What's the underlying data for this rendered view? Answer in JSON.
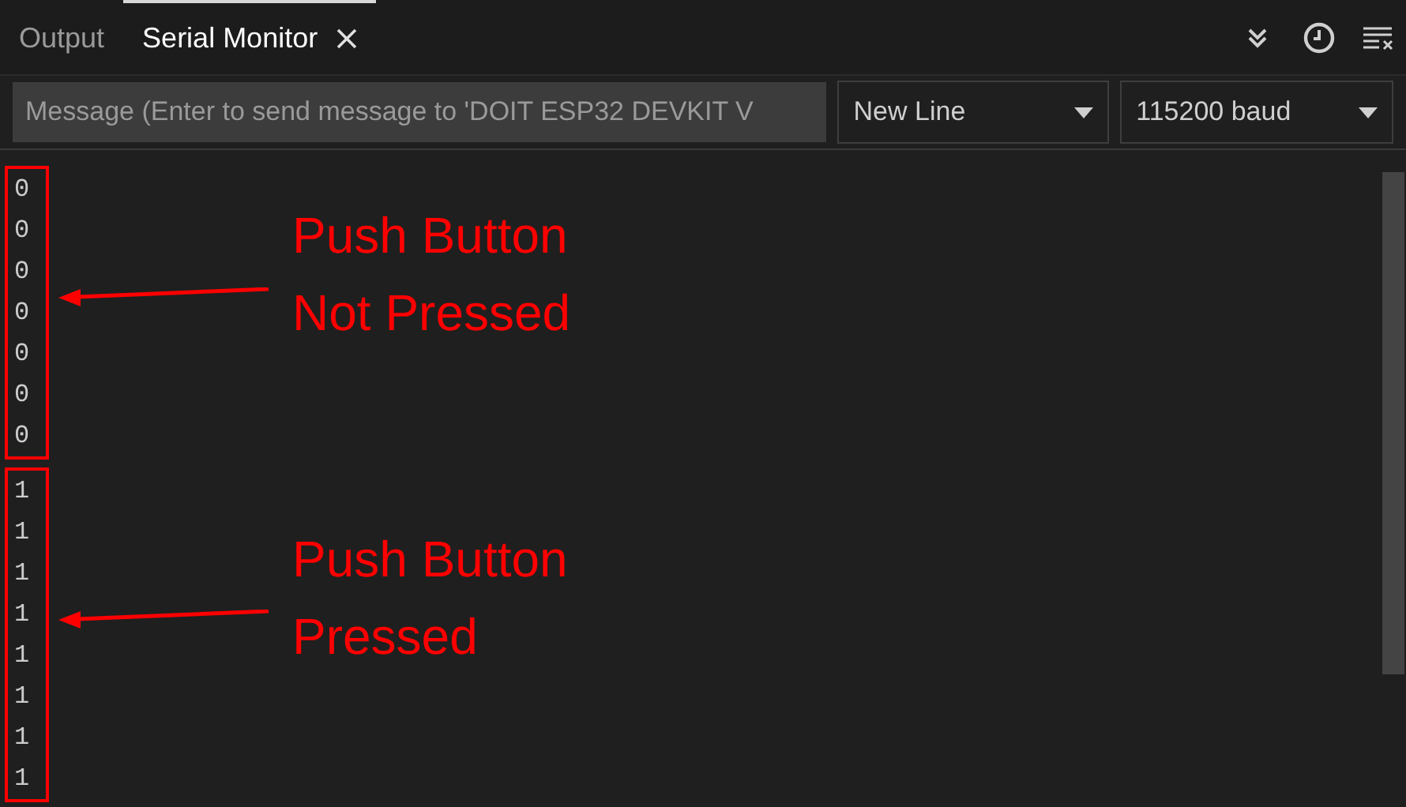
{
  "tabs": [
    {
      "label": "Output",
      "selected": false,
      "closable": false
    },
    {
      "label": "Serial Monitor",
      "selected": true,
      "closable": true
    }
  ],
  "message_field": {
    "placeholder": "Message (Enter to send message to 'DOIT ESP32 DEVKIT V"
  },
  "line_ending": {
    "value": "New Line"
  },
  "baud_rate": {
    "value": "115200 baud"
  },
  "output_groups": [
    {
      "lines": [
        "0",
        "0",
        "0",
        "0",
        "0",
        "0",
        "0"
      ],
      "annotation": [
        "Push Button",
        "Not Pressed"
      ]
    },
    {
      "lines": [
        "1",
        "1",
        "1",
        "1",
        "1",
        "1",
        "1",
        "1"
      ],
      "annotation": [
        "Push Button",
        "Pressed"
      ]
    }
  ]
}
